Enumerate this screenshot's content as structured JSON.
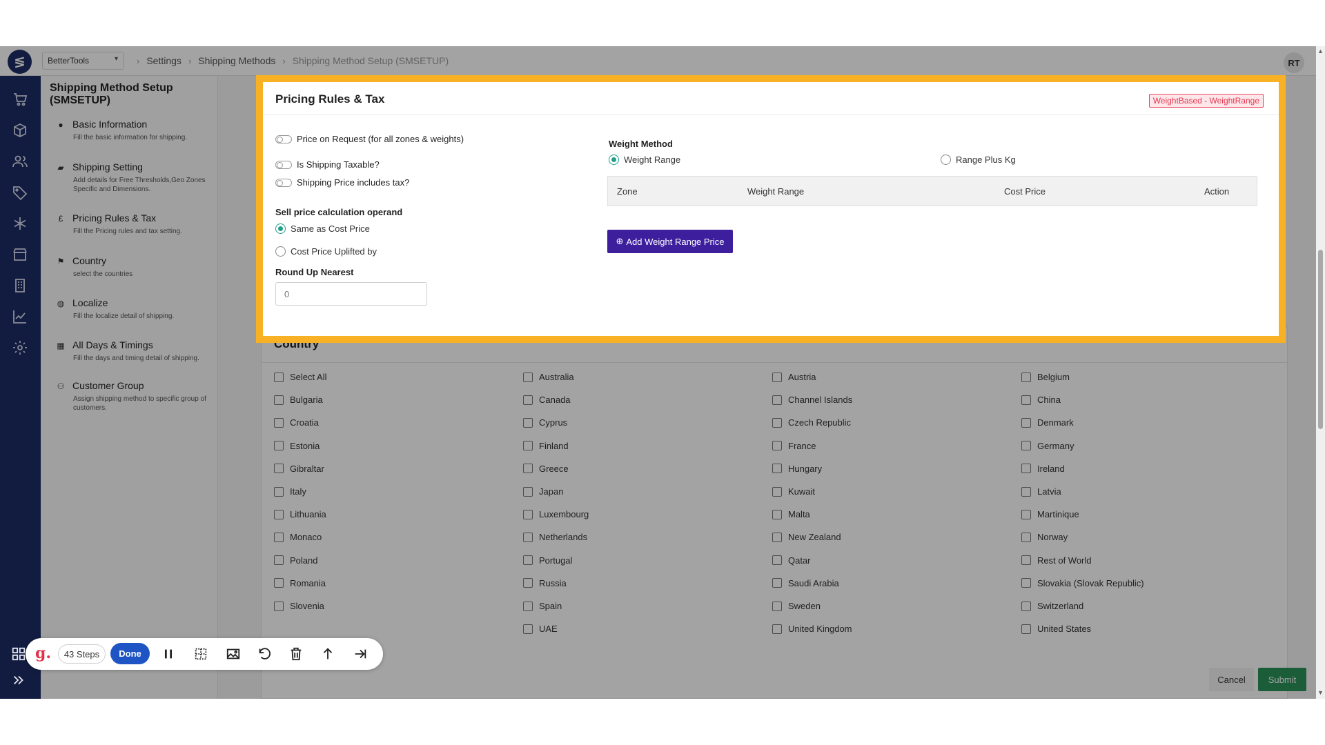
{
  "topbar": {
    "store": "BetterTools",
    "breadcrumb": [
      "Settings",
      "Shipping Methods",
      "Shipping Method Setup (SMSETUP)"
    ],
    "avatar": "RT"
  },
  "steps": {
    "title": "Shipping Method Setup (SMSETUP)",
    "items": [
      {
        "label": "Basic Information",
        "desc": "Fill the basic information for shipping."
      },
      {
        "label": "Shipping Setting",
        "desc": "Add details for Free Thresholds,Geo Zones Specific and Dimensions."
      },
      {
        "label": "Pricing Rules & Tax",
        "desc": "Fill the Pricing rules and tax setting."
      },
      {
        "label": "Country",
        "desc": "select the countries"
      },
      {
        "label": "Localize",
        "desc": "Fill the localize detail of shipping."
      },
      {
        "label": "All Days & Timings",
        "desc": "Fill the days and timing detail of shipping."
      },
      {
        "label": "Customer Group",
        "desc": "Assign shipping method to specific group of customers."
      }
    ]
  },
  "pricing": {
    "title": "Pricing Rules & Tax",
    "badge": "WeightBased - WeightRange",
    "toggles": [
      "Price on Request (for all zones & weights)",
      "Is Shipping Taxable?",
      "Shipping Price includes tax?"
    ],
    "sell_label": "Sell price calculation operand",
    "sell_options": [
      "Same as Cost Price",
      "Cost Price Uplifted by"
    ],
    "round_label": "Round Up Nearest",
    "round_value": "0",
    "weight_method_label": "Weight Method",
    "weight_options": [
      "Weight Range",
      "Range Plus Kg"
    ],
    "table_headers": [
      "Zone",
      "Weight Range",
      "Cost Price",
      "Action"
    ],
    "add_button": "Add Weight Range Price"
  },
  "country": {
    "title": "Country",
    "columns": [
      [
        "Select All",
        "Bulgaria",
        "Croatia",
        "Estonia",
        "Gibraltar",
        "Italy",
        "Lithuania",
        "Monaco",
        "Poland",
        "Romania",
        "Slovenia"
      ],
      [
        "Australia",
        "Canada",
        "Cyprus",
        "Finland",
        "Greece",
        "Japan",
        "Luxembourg",
        "Netherlands",
        "Portugal",
        "Russia",
        "Spain",
        "UAE"
      ],
      [
        "Austria",
        "Channel Islands",
        "Czech Republic",
        "France",
        "Hungary",
        "Kuwait",
        "Malta",
        "New Zealand",
        "Qatar",
        "Saudi Arabia",
        "Sweden",
        "United Kingdom"
      ],
      [
        "Belgium",
        "China",
        "Denmark",
        "Germany",
        "Ireland",
        "Latvia",
        "Martinique",
        "Norway",
        "Rest of World",
        "Slovakia (Slovak Republic)",
        "Switzerland",
        "United States"
      ]
    ]
  },
  "actions": {
    "cancel": "Cancel",
    "submit": "Submit"
  },
  "recorder": {
    "logo": "g.",
    "steps": "43 Steps",
    "done": "Done"
  },
  "colors": {
    "accent": "#f8b125",
    "brand": "#1c2c64",
    "primary_button": "#3d1f9e",
    "submit": "#2b9159",
    "radio_on": "#1f9f8a",
    "badge": "#e53950"
  }
}
